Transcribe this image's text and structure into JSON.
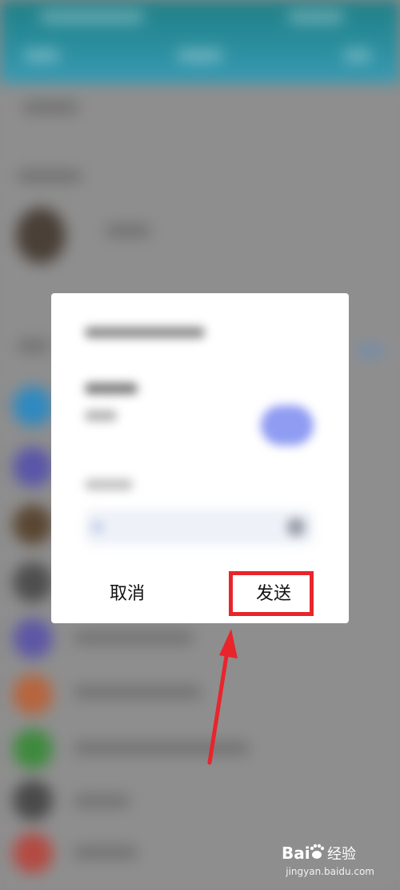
{
  "dialog": {
    "cancel_label": "取消",
    "send_label": "发送"
  },
  "annotation": {
    "highlight_color": "#e8252b",
    "arrow_color": "#e8252b",
    "target": "send-button"
  },
  "colors": {
    "header_teal": "#2c8fa0",
    "overlay_gray": "#8c8c8c",
    "accent_pill": "#8f9cf2"
  },
  "watermark": {
    "brand": "Baidu经验",
    "url": "jingyan.baidu.com"
  }
}
